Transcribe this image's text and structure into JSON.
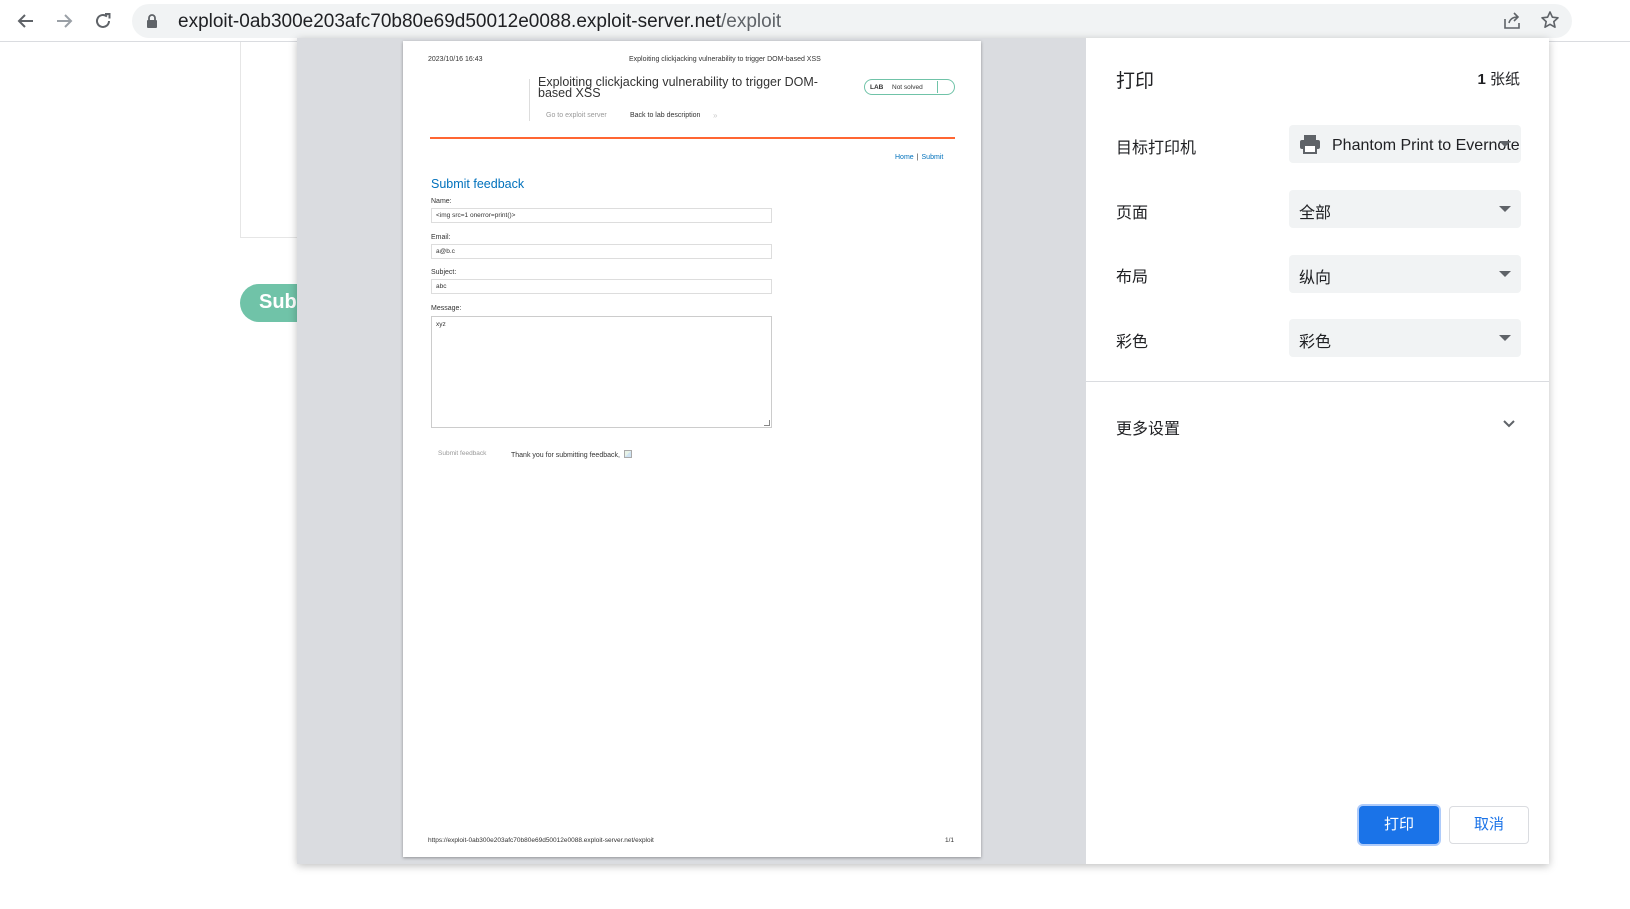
{
  "browser": {
    "url_host": "exploit-0ab300e203afc70b80e69d50012e0088.exploit-server.net",
    "url_path": "/exploit"
  },
  "background_page": {
    "submit_button_label": "Sub"
  },
  "preview": {
    "header_date": "2023/10/16 16:43",
    "header_title": "Exploiting clickjacking vulnerability to trigger DOM-based XSS",
    "lab_title": "Exploiting clickjacking vulnerability to trigger DOM-based XSS",
    "badge_lab": "LAB",
    "badge_status": "Not solved",
    "link_exploit_server": "Go to exploit server",
    "link_back": "Back to lab description",
    "link_back_chevron": "»",
    "nav_home": "Home",
    "nav_separator": "|",
    "nav_submit": "Submit",
    "form_title": "Submit feedback",
    "fields": {
      "name_label": "Name:",
      "name_value": "<img src=1 onerror=print()>",
      "email_label": "Email:",
      "email_value": "a@b.c",
      "subject_label": "Subject:",
      "subject_value": "abc",
      "message_label": "Message:",
      "message_value": "xyz"
    },
    "submit_label": "Submit feedback",
    "thanks_text": "Thank you for submitting feedback,",
    "footer_url": "https://exploit-0ab300e203afc70b80e69d50012e0088.exploit-server.net/exploit",
    "footer_page": "1/1"
  },
  "settings": {
    "title": "打印",
    "sheet_count": "1",
    "sheet_unit": "张纸",
    "destination_label": "目标打印机",
    "destination_value": "Phantom Print to Evernote",
    "pages_label": "页面",
    "pages_value": "全部",
    "layout_label": "布局",
    "layout_value": "纵向",
    "color_label": "彩色",
    "color_value": "彩色",
    "more_settings": "更多设置",
    "print_button": "打印",
    "cancel_button": "取消"
  },
  "colors": {
    "accent_blue": "#1a73e8",
    "lab_red_line": "#ff6633",
    "lab_link_blue": "#0071bc",
    "lab_green": "#70c3a8"
  }
}
